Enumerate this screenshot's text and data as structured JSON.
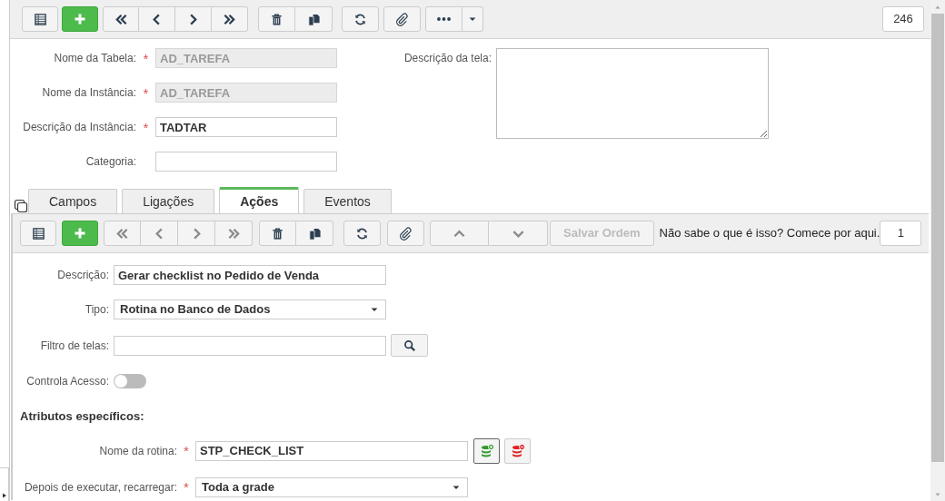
{
  "top_bar": {
    "record_count": "246"
  },
  "main_fields": [
    {
      "label": "Nome da Tabela:",
      "required_mark": "*",
      "value": "AD_TAREFA",
      "disabled": true
    },
    {
      "label": "Nome da Instância:",
      "required_mark": "*",
      "value": "AD_TAREFA",
      "disabled": true
    },
    {
      "label": "Descrição da Instância:",
      "required_mark": "*",
      "value": "TADTAR",
      "disabled": false
    },
    {
      "label": "Categoria:",
      "disabled": false
    }
  ],
  "screen_description": {
    "label": "Descrição da tela:"
  },
  "tabs": [
    {
      "label": "Campos",
      "selected": false
    },
    {
      "label": "Ligações",
      "selected": false
    },
    {
      "label": "Ações",
      "selected": true
    },
    {
      "label": "Eventos",
      "selected": false
    }
  ],
  "actions_toolbar": {
    "save_order": {
      "label": "Salvar Ordem",
      "disabled": true
    },
    "help_link": "Não sabe o que é isso? Comece por aqui.",
    "record_count": "1"
  },
  "action_fields": [
    {
      "kind": "text",
      "label": "Descrição:",
      "value": "Gerar checklist no Pedido de Venda"
    },
    {
      "kind": "select",
      "label": "Tipo:",
      "value": "Rotina no Banco de Dados"
    },
    {
      "kind": "search",
      "label": "Filtro de telas:"
    },
    {
      "kind": "toggle",
      "label": "Controla Acesso:",
      "on": false
    }
  ],
  "specific_attributes": {
    "title": "Atributos específicos:",
    "fields": [
      {
        "kind": "routine",
        "label": "Nome da rotina:",
        "required_mark": "*",
        "value": "STP_CHECK_LIST"
      },
      {
        "kind": "select",
        "label": "Depois de executar, recarregar:",
        "required_mark": "*",
        "value": "Toda a grade"
      }
    ]
  }
}
